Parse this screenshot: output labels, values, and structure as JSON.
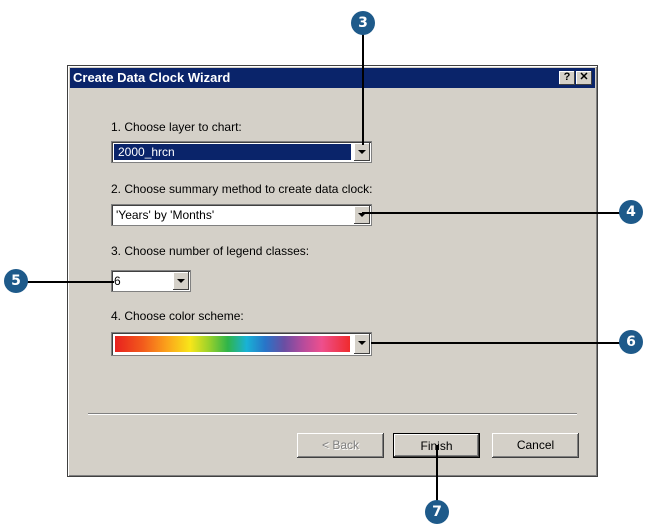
{
  "dialog": {
    "title": "Create Data Clock Wizard",
    "help_btn": "?",
    "close_btn": "✕"
  },
  "fields": {
    "layer_label": "1. Choose layer to chart:",
    "layer_value": "2000_hrcn",
    "summary_label": "2. Choose summary method to create data clock:",
    "summary_value": "'Years' by 'Months'",
    "classes_label": "3. Choose number of legend classes:",
    "classes_value": "6",
    "scheme_label": "4. Choose color scheme:"
  },
  "buttons": {
    "back": "< Back",
    "finish": "Finish",
    "cancel": "Cancel"
  },
  "callouts": {
    "c3": "3",
    "c4": "4",
    "c5": "5",
    "c6": "6",
    "c7": "7"
  },
  "colors": {
    "titlebar": "#0a246a",
    "callout": "#1e5a8a",
    "dialog_bg": "#d4d0c8"
  }
}
